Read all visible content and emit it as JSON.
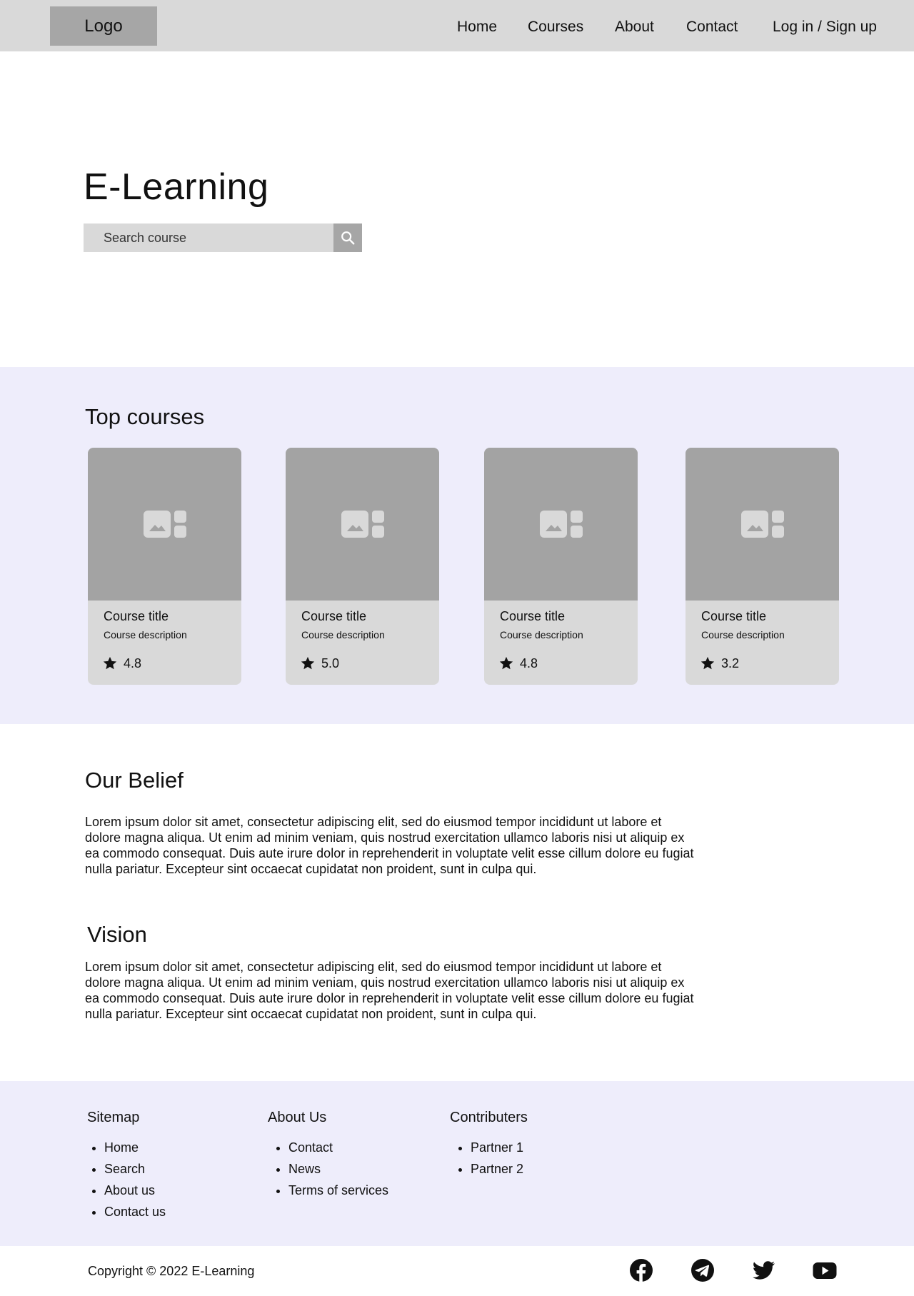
{
  "header": {
    "logo": "Logo",
    "nav": [
      "Home",
      "Courses",
      "About",
      "Contact"
    ],
    "auth": "Log in / Sign up"
  },
  "hero": {
    "title": "E-Learning",
    "search_placeholder": "Search course",
    "search_icon": "search-icon"
  },
  "top_courses": {
    "heading": "Top courses",
    "cards": [
      {
        "title": "Course title",
        "description": "Course description",
        "rating": "4.8"
      },
      {
        "title": "Course title",
        "description": "Course description",
        "rating": "5.0"
      },
      {
        "title": "Course title",
        "description": "Course description",
        "rating": "4.8"
      },
      {
        "title": "Course title",
        "description": "Course description",
        "rating": "3.2"
      }
    ]
  },
  "belief": {
    "heading": "Our Belief",
    "body": "Lorem ipsum dolor sit amet, consectetur adipiscing elit, sed do eiusmod tempor incididunt ut labore et dolore magna aliqua. Ut enim ad minim veniam, quis nostrud exercitation ullamco laboris nisi ut aliquip ex ea commodo consequat. Duis aute irure dolor in reprehenderit in voluptate velit esse cillum dolore eu fugiat nulla pariatur. Excepteur sint occaecat cupidatat non proident, sunt in culpa qui."
  },
  "vision": {
    "heading": "Vision",
    "body": "Lorem ipsum dolor sit amet, consectetur adipiscing elit, sed do eiusmod tempor incididunt ut labore et dolore magna aliqua. Ut enim ad minim veniam, quis nostrud exercitation ullamco laboris nisi ut aliquip ex ea commodo consequat. Duis aute irure dolor in reprehenderit in voluptate velit esse cillum dolore eu fugiat nulla pariatur. Excepteur sint occaecat cupidatat non proident, sunt in culpa qui."
  },
  "footer": {
    "sitemap": {
      "title": "Sitemap",
      "items": [
        "Home",
        "Search",
        "About us",
        "Contact us"
      ]
    },
    "about": {
      "title": "About Us",
      "items": [
        "Contact",
        "News",
        "Terms of services"
      ]
    },
    "contributors": {
      "title": "Contributers",
      "items": [
        "Partner 1",
        "Partner 2"
      ]
    },
    "copyright": "Copyright © 2022 E-Learning",
    "social_icons": [
      "facebook-icon",
      "telegram-icon",
      "twitter-icon",
      "youtube-icon"
    ]
  },
  "colors": {
    "header_bg": "#d9d9d9",
    "section_bg": "#eeedfb",
    "placeholder_gray": "#a3a3a3",
    "card_bg": "#d9d9d9"
  }
}
